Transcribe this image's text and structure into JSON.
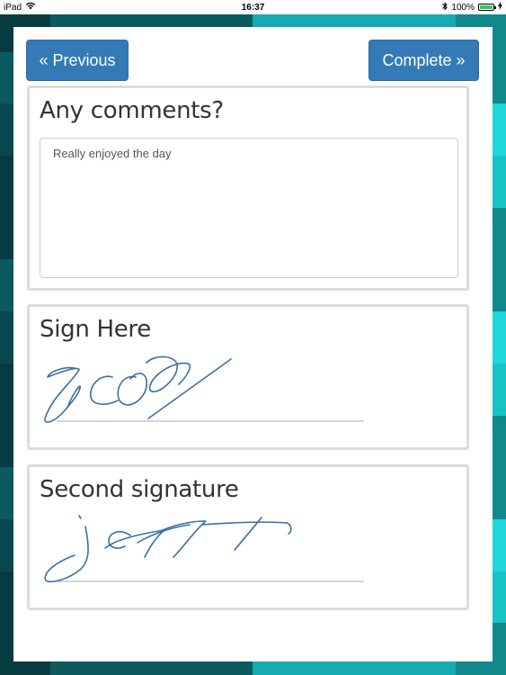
{
  "status_bar": {
    "device": "iPad",
    "time": "16:37",
    "battery": "100%",
    "battery_level": 1.0
  },
  "nav": {
    "previous_label": "« Previous",
    "complete_label": "Complete »"
  },
  "comments": {
    "title": "Any comments?",
    "value": "Really enjoyed the day"
  },
  "signature1": {
    "title": "Sign Here"
  },
  "signature2": {
    "title": "Second signature"
  },
  "colors": {
    "button": "#337ab7",
    "ink": "#3a6ea5",
    "battery": "#35c759"
  }
}
